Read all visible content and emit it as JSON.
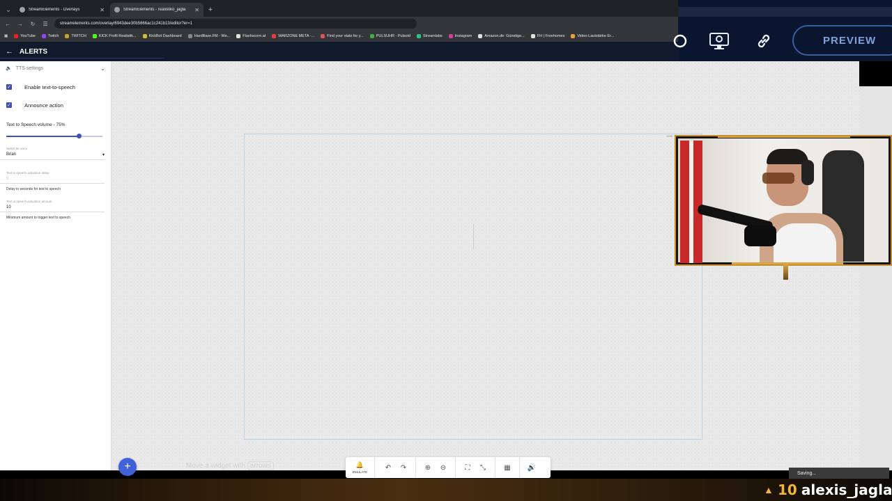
{
  "browser": {
    "tabs": [
      {
        "title": "StreamElements - Overlays",
        "active": false
      },
      {
        "title": "StreamElements - realistiko_jaglа",
        "active": true
      }
    ],
    "url": "streamelements.com/overlay/6943dee30b5666ac1c241b13/editor?er=1",
    "bookmarks": [
      {
        "label": "YouTube",
        "color": "#e02424"
      },
      {
        "label": "Twitch",
        "color": "#9146ff"
      },
      {
        "label": "TWITCH",
        "color": "#c9a227"
      },
      {
        "label": "KICK Profil Realistik...",
        "color": "#53fc18"
      },
      {
        "label": "KickBot Dashboard",
        "color": "#d0c030"
      },
      {
        "label": "HardBase.FM - We...",
        "color": "#888888"
      },
      {
        "label": "Flashscore.at",
        "color": "#e0e0e0"
      },
      {
        "label": "WARZONE META -...",
        "color": "#e04040"
      },
      {
        "label": "Find your stats for y...",
        "color": "#e05050"
      },
      {
        "label": "PULSUHR - Pulsoid",
        "color": "#40b040"
      },
      {
        "label": "Streamlabs",
        "color": "#30c090"
      },
      {
        "label": "Instagram",
        "color": "#d04090"
      },
      {
        "label": "Amazon.de: Günstige...",
        "color": "#e0e0e0"
      },
      {
        "label": "FH | Freehomes",
        "color": "#e0e0e0"
      },
      {
        "label": "Video-Lautstärke Er...",
        "color": "#f0a030"
      }
    ]
  },
  "header": {
    "title": "ALERTS",
    "preview_label": "PREVIEW"
  },
  "panel": {
    "section_title": "TTS settings",
    "enable_tts_label": "Enable text-to-speech",
    "announce_label": "Announce action",
    "volume_label": "Text to Speech volume - 75%",
    "volume_value": 0.75,
    "voice_caption": "Select tts voice",
    "voice_value": "Brian",
    "delay_caption": "Text to speech activation delay",
    "delay_value": "0",
    "delay_help": "Delay in seconds for text to speech",
    "amount_caption": "Text to speech activation amount",
    "amount_value": "10",
    "amount_help": "Minimum amount to trigger text to speech"
  },
  "canvas": {
    "frame_dims": "1920"
  },
  "bottom": {
    "hint_text": "Move a widget with",
    "hint_key": "arrows",
    "emulate_label": "EMULATE",
    "saving_text": "Saving..."
  },
  "stream": {
    "count": "10",
    "username": "alexis_jagla"
  }
}
